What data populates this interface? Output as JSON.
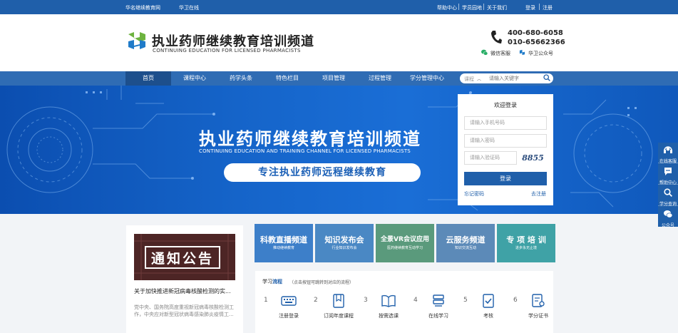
{
  "topbar": {
    "left_links": [
      "华名继续教育网",
      "华卫在线"
    ],
    "right_links": [
      "帮助中心",
      "学员园地",
      "关于我们"
    ],
    "login": "登录",
    "register": "注册"
  },
  "header": {
    "title": "执业药师继续教育培训频道",
    "subtitle": "CONTINUING EDUCATION FOR LICENSED PHARMACISTS",
    "phone1": "400-680-6058",
    "phone2": "010-65662366",
    "wechat_service": "微信客服",
    "official_account": "华卫公众号"
  },
  "nav": {
    "items": [
      "首页",
      "课程中心",
      "药学头条",
      "特色栏目",
      "项目管理",
      "过程管理",
      "学分管理中心"
    ],
    "active_index": 0
  },
  "search": {
    "category": "课程",
    "placeholder": "请输入关键字"
  },
  "banner": {
    "title": "执业药师继续教育培训频道",
    "subtitle": "CONTINUING EDUCATION AND TRAINING CHANNEL FOR LICENSED PHARMACISTS",
    "slogan": "专注执业药师远程继续教育"
  },
  "login": {
    "title": "欢迎登录",
    "phone_placeholder": "请输入手机号码",
    "password_placeholder": "请输入密码",
    "captcha_placeholder": "请输入验证码",
    "captcha_code": "8855",
    "button": "登录",
    "forgot": "忘记密码",
    "register": "去注册"
  },
  "float_bar": [
    {
      "icon": "headset-icon",
      "label": "在线客服"
    },
    {
      "icon": "help-icon",
      "label": "帮助中心"
    },
    {
      "icon": "search-icon",
      "label": "学分查询"
    },
    {
      "icon": "wechat-icon",
      "label": "公众号"
    }
  ],
  "notice": {
    "image_text": "通知公告",
    "title": "关于加快推进新冠病毒核酸检测的实...",
    "text": [
      "党中央、国务院高度重视新冠病毒核酸检测工",
      "作，中央应对新型冠状病毒感染肺炎疫情工..."
    ]
  },
  "channels": [
    {
      "title": "科教直播频道",
      "sub": "推动继续教育",
      "color": "#3d7fc9"
    },
    {
      "title": "知识发布会",
      "sub": "行业知识发布会",
      "color": "#4a88c4"
    },
    {
      "title": "全景VR会议应用",
      "sub": "医药继续教育互动学习",
      "color": "#5a9a7c"
    },
    {
      "title": "云服务频道",
      "sub": "知识交流互动",
      "color": "#5c8ab8"
    },
    {
      "title": "专 项 培 训",
      "sub": "进步永无止境",
      "color": "#3fa2a6"
    }
  ],
  "process": {
    "title_plain": "学习",
    "title_highlight": "流程",
    "hint": "（点击按钮可跳转到对应的流程）",
    "steps": [
      {
        "num": "1",
        "label": "注册登录",
        "icon": "keyboard-icon"
      },
      {
        "num": "2",
        "label": "订阅年度课程",
        "icon": "bookmark-icon"
      },
      {
        "num": "3",
        "label": "按需选课",
        "icon": "book-icon"
      },
      {
        "num": "4",
        "label": "在线学习",
        "icon": "stack-icon"
      },
      {
        "num": "5",
        "label": "考核",
        "icon": "checkbox-icon"
      },
      {
        "num": "6",
        "label": "学分证书",
        "icon": "certificate-icon"
      }
    ]
  }
}
